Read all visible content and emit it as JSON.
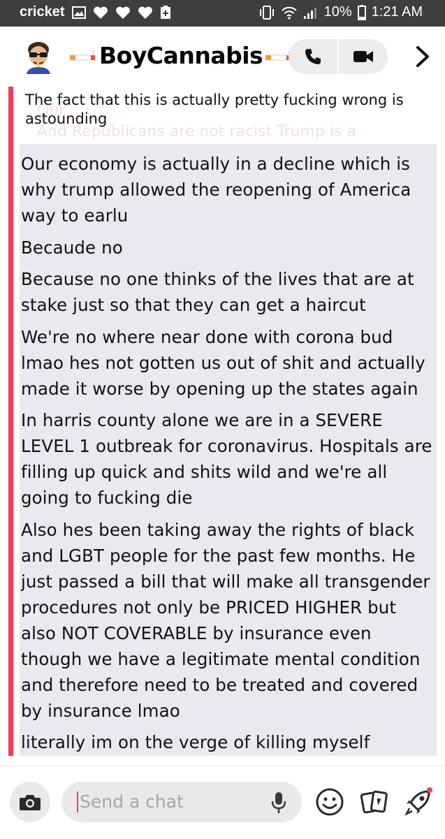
{
  "status_bar": {
    "carrier": "cricket",
    "battery": "10%",
    "time": "1:21 AM"
  },
  "header": {
    "contact_name": "BoyCannabis"
  },
  "chat": {
    "quoted_ghost": "Our\nAnd Republicans are not racist Trump is a\nRepublican they don't care about race they just",
    "quoted_reply": "The fact that this is actually pretty fucking wrong is astounding",
    "messages": [
      "Our economy is actually in a decline which is why trump allowed the reopening of America way to earlu",
      "Becaude no",
      "Because no one thinks of the lives that are at stake just so that they can get a haircut",
      "We're no where near done with corona bud lmao hes not gotten us out of shit and actually made it worse by opening up the states again",
      "In harris county alone we are in a SEVERE LEVEL 1 outbreak for coronavirus. Hospitals are filling up quick and shits wild and we're all going to fucking die",
      "Also hes been taking away the rights of black and LGBT people for the past few months. He just passed a bill that will make all transgender procedures not only be PRICED HIGHER but also NOT COVERABLE by insurance even though we have a legitimate mental condition and therefore need to be treated and covered by insurance lmao",
      "literally im on the verge of killing myself"
    ]
  },
  "footer": {
    "input_placeholder": "Send a chat"
  },
  "colors": {
    "accent_red": "#ef3e57",
    "bubble_bg": "#e8eaef",
    "status_bar_bg": "#3e3e3e",
    "pill_bg": "#e9e9e9"
  }
}
